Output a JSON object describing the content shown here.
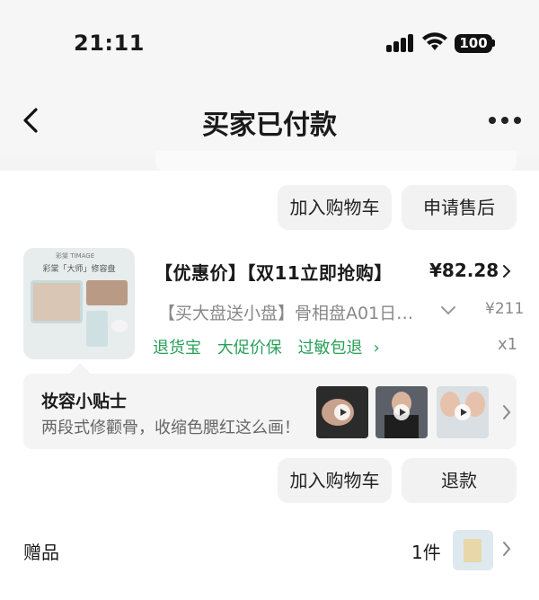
{
  "status_bar": {
    "time": "21:11",
    "battery": "100"
  },
  "nav": {
    "title": "买家已付款",
    "back_icon": "chevron-left-icon",
    "more_icon": "more-dots-icon"
  },
  "prev_item": {
    "buttons": {
      "add_cart": "加入购物车",
      "after_sale": "申请售后"
    }
  },
  "product": {
    "title": "【优惠价】【双11立即抢购】",
    "price": "¥82.28",
    "subtitle": "【买大盘送小盘】骨相盘A01日…",
    "original_price": "¥211",
    "tags": [
      "退货宝",
      "大促价保",
      "过敏包退"
    ],
    "quantity": "x1",
    "thumb_brand": "彩棠 TIMAGE",
    "thumb_title": "彩棠「大师」修容盘",
    "buttons": {
      "add_cart": "加入购物车",
      "refund": "退款"
    }
  },
  "tips": {
    "title": "妆容小贴士",
    "text": "两段式修颧骨，收缩色腮红这么画！"
  },
  "gift": {
    "label": "赠品",
    "count": "1件"
  },
  "colors": {
    "green": "#2aa05a",
    "button_bg": "#f2f2f2",
    "tips_bg": "#f4f4f4"
  }
}
